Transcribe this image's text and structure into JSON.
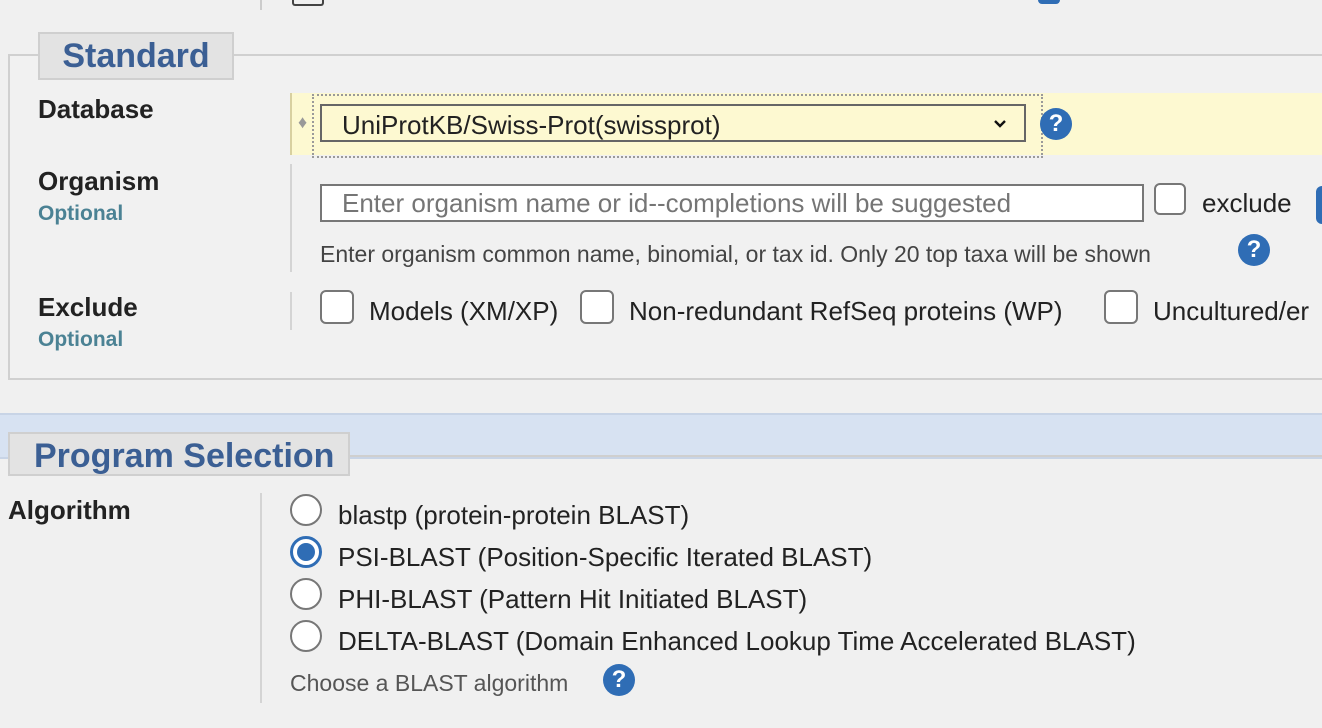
{
  "standard": {
    "legend": "Standard",
    "database": {
      "label": "Database",
      "selected": "UniProtKB/Swiss-Prot(swissprot)",
      "help": "?"
    },
    "organism": {
      "label": "Organism",
      "optional": "Optional",
      "placeholder": "Enter organism name or id--completions will be suggested",
      "exclude_label": "exclude",
      "hint": "Enter organism common name, binomial, or tax id. Only 20 top taxa will be shown",
      "help": "?"
    },
    "exclude": {
      "label": "Exclude",
      "optional": "Optional",
      "options": [
        "Models (XM/XP)",
        "Non-redundant RefSeq proteins (WP)",
        "Uncultured/er"
      ]
    }
  },
  "program": {
    "legend": "Program Selection",
    "algorithm_label": "Algorithm",
    "options": [
      "blastp (protein-protein BLAST)",
      "PSI-BLAST (Position-Specific Iterated BLAST)",
      "PHI-BLAST (Pattern Hit Initiated BLAST)",
      "DELTA-BLAST (Domain Enhanced Lookup Time Accelerated BLAST)"
    ],
    "selected_index": 1,
    "hint": "Choose a BLAST algorithm",
    "help": "?"
  },
  "colors": {
    "accent": "#2f6db5",
    "legend_text": "#3b5f94",
    "optional_text": "#4b8294",
    "db_row_bg": "#fdf9d1",
    "program_band": "#d7e2f2"
  }
}
